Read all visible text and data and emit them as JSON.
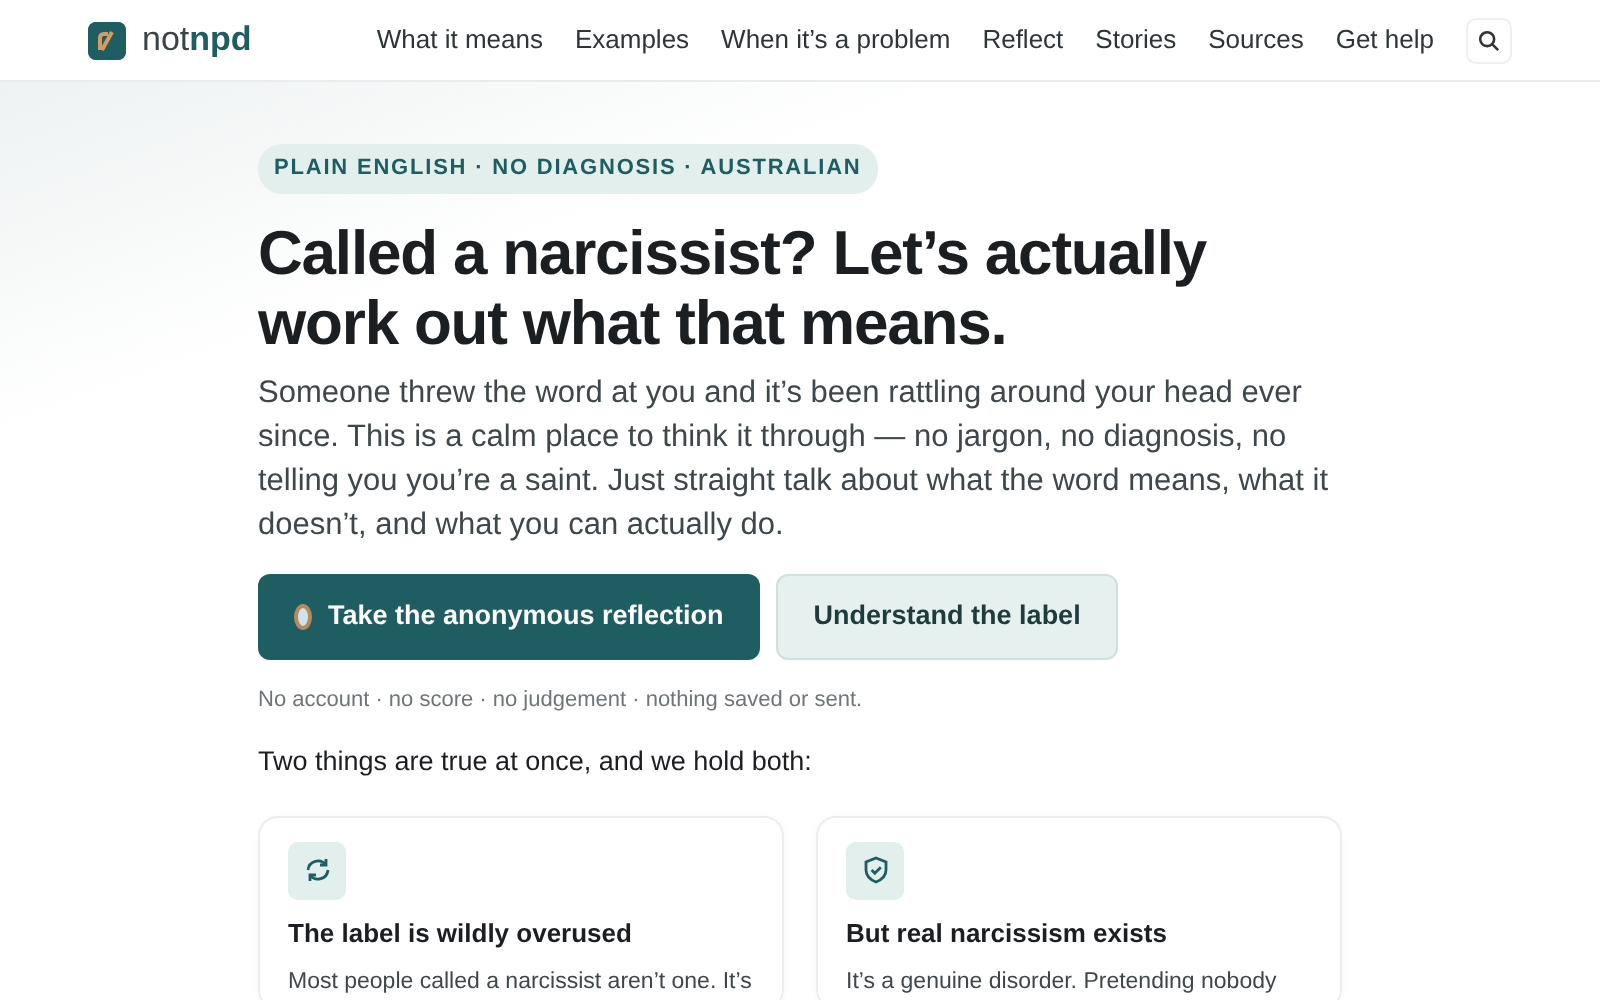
{
  "brand": {
    "prefix": "not",
    "name": "npd"
  },
  "nav": [
    {
      "label": "What it means"
    },
    {
      "label": "Examples"
    },
    {
      "label": "When it’s a problem"
    },
    {
      "label": "Reflect"
    },
    {
      "label": "Stories"
    },
    {
      "label": "Sources"
    },
    {
      "label": "Get help"
    }
  ],
  "eyebrow": "PLAIN ENGLISH · NO DIAGNOSIS · AUSTRALIAN",
  "title": "Called a narcissist? Let’s actually work out what that means.",
  "intro": "Someone threw the word at you and it’s been rattling around your head ever since. This is a calm place to think it through — no jargon, no diagnosis, no telling you you’re a saint. Just straight talk about what the word means, what it doesn’t, and what you can actually do.",
  "buttons": [
    {
      "label": "Take the anonymous reflection",
      "kind": "primary"
    },
    {
      "label": "Understand the label",
      "kind": "secondary"
    }
  ],
  "note": "No account · no score · no judgement · nothing saved or sent.",
  "lead_in": "Two things are true at once, and we hold both:",
  "cards": [
    {
      "title": "The label is wildly overused",
      "text": "Most people called a narcissist aren’t one. It’s"
    },
    {
      "title": "But real narcissism exists",
      "text": "It’s a genuine disorder. Pretending nobody"
    }
  ]
}
